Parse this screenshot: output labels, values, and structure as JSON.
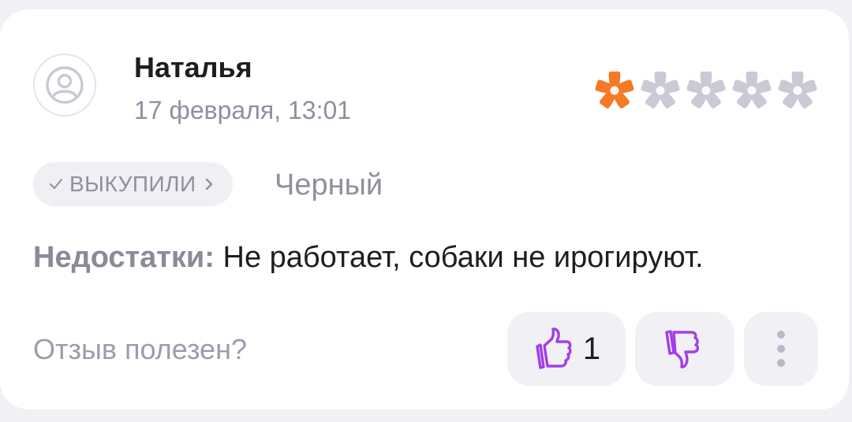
{
  "review": {
    "author": "Наталья",
    "date": "17 февраля, 13:01",
    "rating": 1,
    "rating_max": 5,
    "rating_color_filled": "#f57a25",
    "rating_color_empty": "#cacad6",
    "purchase_badge": "ВЫКУПИЛИ",
    "variant": "Черный",
    "cons_label": "Недостатки:",
    "cons_text": " Не работает, собаки не ирогируют."
  },
  "feedback": {
    "question": "Отзыв полезен?",
    "like_count": "1",
    "accent_color": "#a23ee8"
  },
  "icons": {
    "avatar": "user-icon",
    "check": "check-icon",
    "chevron": "chevron-right-icon",
    "like": "thumbs-up-icon",
    "dislike": "thumbs-down-icon",
    "more": "more-vertical-icon"
  }
}
